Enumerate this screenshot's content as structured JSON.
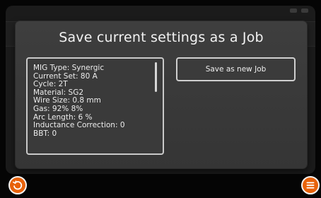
{
  "modal": {
    "title": "Save current settings as a Job",
    "settings": [
      "MIG Type: Synergic",
      "Current Set: 80 A",
      "Cycle: 2T",
      "Material: SG2",
      "Wire Size: 0.8 mm",
      "Gas: 92% 8%",
      "Arc Length: 6 %",
      "Inductance Correction: 0",
      "BBT: 0"
    ],
    "save_button_label": "Save as new Job"
  },
  "footer": {
    "back_icon": "back-icon",
    "menu_icon": "menu-icon"
  },
  "colors": {
    "accent": "#e8620a",
    "modal_bg": "#3b3b3b",
    "border": "#cfcfcf"
  }
}
